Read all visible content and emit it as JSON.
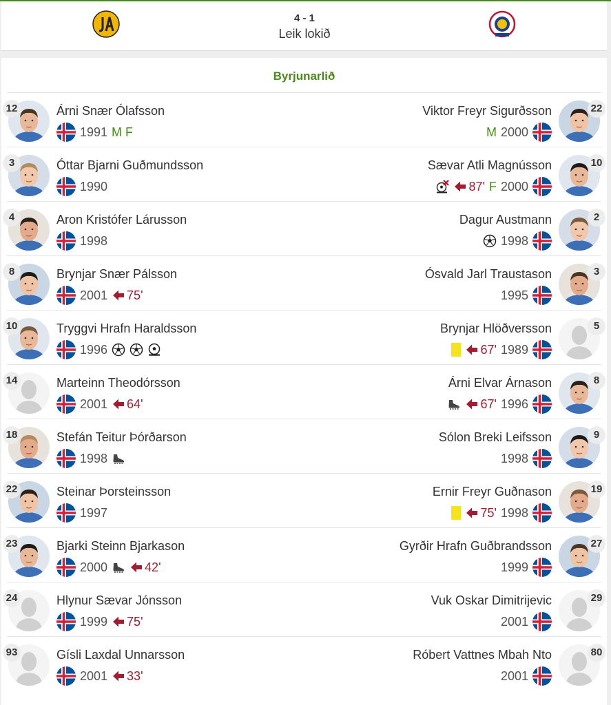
{
  "header": {
    "score": "4 - 1",
    "status": "Leik lokið",
    "home_logo": "ia-crest-icon",
    "away_logo": "leiknir-crest-icon"
  },
  "lineup": {
    "title": "Byrjunarlið",
    "rows": [
      {
        "home": {
          "num": "12",
          "name": "Árni Snær Ólafsson",
          "year": "1991",
          "pos": "M F",
          "events": []
        },
        "away": {
          "num": "22",
          "name": "Viktor Freyr Sigurðsson",
          "year": "2000",
          "pos": "M",
          "events": []
        }
      },
      {
        "home": {
          "num": "3",
          "name": "Óttar Bjarni Guðmundsson",
          "year": "1990",
          "pos": "",
          "events": []
        },
        "away": {
          "num": "10",
          "name": "Sævar Atli Magnússon",
          "year": "2000",
          "pos": "F",
          "events": [
            {
              "type": "missed-penalty"
            },
            {
              "type": "sub-off",
              "min": "87'"
            }
          ]
        }
      },
      {
        "home": {
          "num": "4",
          "name": "Aron Kristófer Lárusson",
          "year": "1998",
          "pos": "",
          "events": []
        },
        "away": {
          "num": "2",
          "name": "Dagur Austmann",
          "year": "1998",
          "pos": "",
          "events": [
            {
              "type": "goal"
            }
          ]
        }
      },
      {
        "home": {
          "num": "8",
          "name": "Brynjar Snær Pálsson",
          "year": "2001",
          "pos": "",
          "events": [
            {
              "type": "sub-off",
              "min": "75'"
            }
          ]
        },
        "away": {
          "num": "3",
          "name": "Ósvald Jarl Traustason",
          "year": "1995",
          "pos": "",
          "events": []
        }
      },
      {
        "home": {
          "num": "10",
          "name": "Tryggvi Hrafn Haraldsson",
          "year": "1996",
          "pos": "",
          "events": [
            {
              "type": "goal"
            },
            {
              "type": "goal"
            },
            {
              "type": "penalty-goal"
            }
          ]
        },
        "away": {
          "num": "5",
          "name": "Brynjar Hlöðversson",
          "year": "1989",
          "pos": "",
          "events": [
            {
              "type": "yellow-card"
            },
            {
              "type": "sub-off",
              "min": "67'"
            }
          ]
        }
      },
      {
        "home": {
          "num": "14",
          "name": "Marteinn Theodórsson",
          "year": "2001",
          "pos": "",
          "events": [
            {
              "type": "sub-off",
              "min": "64'"
            }
          ]
        },
        "away": {
          "num": "8",
          "name": "Árni Elvar Árnason",
          "year": "1996",
          "pos": "",
          "events": [
            {
              "type": "assist"
            },
            {
              "type": "sub-off",
              "min": "67'"
            }
          ]
        }
      },
      {
        "home": {
          "num": "18",
          "name": "Stefán Teitur Þórðarson",
          "year": "1998",
          "pos": "",
          "events": [
            {
              "type": "assist"
            }
          ]
        },
        "away": {
          "num": "9",
          "name": "Sólon Breki Leifsson",
          "year": "1998",
          "pos": "",
          "events": []
        }
      },
      {
        "home": {
          "num": "22",
          "name": "Steinar Þorsteinsson",
          "year": "1997",
          "pos": "",
          "events": []
        },
        "away": {
          "num": "19",
          "name": "Ernir Freyr Guðnason",
          "year": "1998",
          "pos": "",
          "events": [
            {
              "type": "yellow-card"
            },
            {
              "type": "sub-off",
              "min": "75'"
            }
          ]
        }
      },
      {
        "home": {
          "num": "23",
          "name": "Bjarki Steinn Bjarkason",
          "year": "2000",
          "pos": "",
          "events": [
            {
              "type": "assist"
            },
            {
              "type": "sub-off",
              "min": "42'"
            }
          ]
        },
        "away": {
          "num": "27",
          "name": "Gyrðir Hrafn Guðbrandsson",
          "year": "1999",
          "pos": "",
          "events": []
        }
      },
      {
        "home": {
          "num": "24",
          "name": "Hlynur Sævar Jónsson",
          "year": "1999",
          "pos": "",
          "events": [
            {
              "type": "sub-off",
              "min": "75'"
            }
          ]
        },
        "away": {
          "num": "29",
          "name": "Vuk Oskar Dimitrijevic",
          "year": "2001",
          "pos": "",
          "events": []
        }
      },
      {
        "home": {
          "num": "93",
          "name": "Gísli Laxdal Unnarsson",
          "year": "2001",
          "pos": "",
          "events": [
            {
              "type": "sub-off",
              "min": "33'"
            }
          ]
        },
        "away": {
          "num": "80",
          "name": "Róbert Vattnes Mbah Nto",
          "year": "2001",
          "pos": "",
          "events": []
        }
      }
    ],
    "photos": {
      "home": [
        true,
        true,
        true,
        true,
        true,
        false,
        true,
        true,
        true,
        false,
        false
      ],
      "away": [
        true,
        true,
        true,
        true,
        false,
        true,
        true,
        true,
        true,
        false,
        false
      ]
    }
  },
  "colors": {
    "accent_green": "#4a8a1c",
    "sub_red": "#a51c30",
    "yellow_card": "#f5e31b"
  }
}
